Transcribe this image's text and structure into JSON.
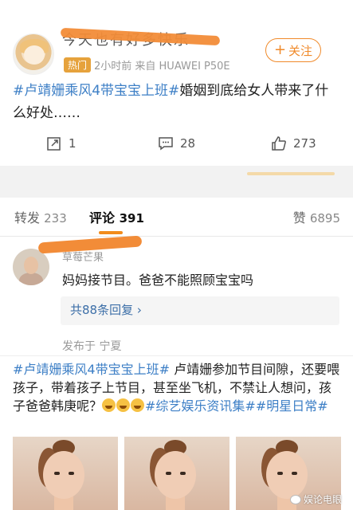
{
  "post": {
    "username": "今天也有好多快乐",
    "hot_badge": "热门",
    "meta": "2小时前  来自 HUAWEI P50E",
    "follow_label": "关注",
    "hashtag": "#卢靖姗乘风4带宝宝上班#",
    "text": "婚姻到底给女人带来了什么好处……",
    "repost_count": "1",
    "comment_count": "28",
    "like_count": "273"
  },
  "tabs": {
    "repost_label": "转发",
    "repost_count": "233",
    "comment_label": "评论",
    "comment_count": "391",
    "like_label": "赞",
    "like_count": "6895"
  },
  "comment": {
    "name": "草莓芒果",
    "text": "妈妈接节目。爸爸不能照顾宝宝吗",
    "replies": "共88条回复 ›",
    "location": "发布于 宁夏"
  },
  "post2": {
    "hashtag1": "#卢靖姗乘风4带宝宝上班#",
    "text": " 卢靖姗参加节目间隙，还要喂孩子，带着孩子上节目，甚至坐飞机，不禁让人想问，孩子爸爸韩庚呢？",
    "hashtag2": "#综艺娱乐资讯集#",
    "hashtag3": "#明星日常#"
  },
  "watermark": "娱论电眼",
  "colors": {
    "accent": "#f08a2a",
    "link": "#3d7fc6"
  }
}
